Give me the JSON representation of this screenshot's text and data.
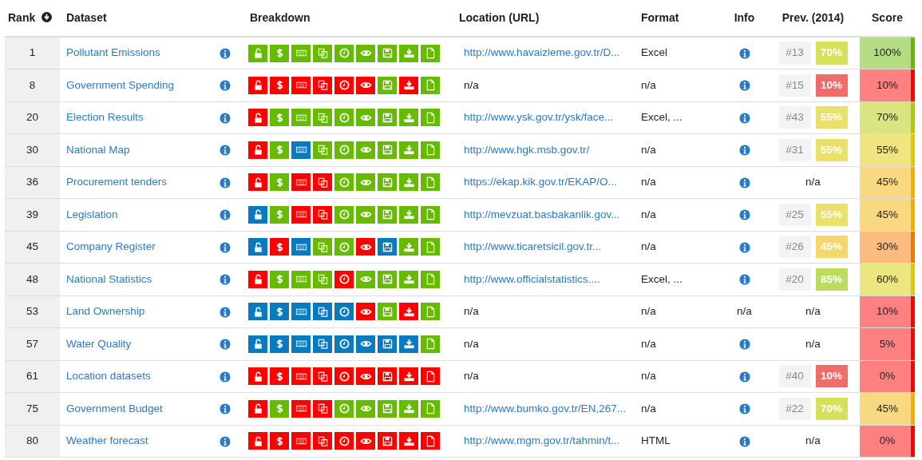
{
  "columns": [
    "Rank",
    "Dataset",
    "Breakdown",
    "Location (URL)",
    "Format",
    "Info",
    "Prev. (2014)",
    "Score"
  ],
  "rows": [
    {
      "rank": "1",
      "dataset": "Pollutant Emissions",
      "breakdown": [
        {
          "color": "#66bb00"
        },
        {
          "color": "#66bb00"
        },
        {
          "color": "#66bb00"
        },
        {
          "color": "#66bb00"
        },
        {
          "color": "#66bb00"
        },
        {
          "color": "#66bb00"
        },
        {
          "color": "#66bb00"
        },
        {
          "color": "#66bb00"
        },
        {
          "color": "#66bb00"
        }
      ],
      "location": {
        "kind": "link",
        "text": "http://www.havaizleme.gov.tr/D..."
      },
      "format": "Excel",
      "info": {
        "kind": "icon"
      },
      "prev": {
        "kind": "badges",
        "rank": "#13",
        "score": "70%",
        "color": "#d5e05b"
      },
      "score": {
        "text": "100%",
        "color": "#66bb00"
      }
    },
    {
      "rank": "8",
      "dataset": "Government Spending",
      "breakdown": [
        {
          "color": "#ff0000"
        },
        {
          "color": "#ff0000"
        },
        {
          "color": "#ff0000"
        },
        {
          "color": "#ff0000"
        },
        {
          "color": "#ff0000"
        },
        {
          "color": "#ff0000"
        },
        {
          "color": "#66bb00"
        },
        {
          "color": "#ff0000"
        },
        {
          "color": "#66bb00"
        }
      ],
      "location": {
        "kind": "text",
        "text": "n/a"
      },
      "format": "n/a",
      "info": {
        "kind": "icon"
      },
      "prev": {
        "kind": "badges",
        "rank": "#15",
        "score": "10%",
        "color": "#f36a6a"
      },
      "score": {
        "text": "10%",
        "color": "#ff0000"
      }
    },
    {
      "rank": "20",
      "dataset": "Election Results",
      "breakdown": [
        {
          "color": "#ff0000"
        },
        {
          "color": "#66bb00"
        },
        {
          "color": "#66bb00"
        },
        {
          "color": "#66bb00"
        },
        {
          "color": "#66bb00"
        },
        {
          "color": "#66bb00"
        },
        {
          "color": "#66bb00"
        },
        {
          "color": "#66bb00"
        },
        {
          "color": "#66bb00"
        }
      ],
      "location": {
        "kind": "link",
        "text": "http://www.ysk.gov.tr/ysk/face..."
      },
      "format": "Excel, ...",
      "info": {
        "kind": "icon"
      },
      "prev": {
        "kind": "badges",
        "rank": "#43",
        "score": "55%",
        "color": "#ebe06a"
      },
      "score": {
        "text": "70%",
        "color": "#b5c800"
      }
    },
    {
      "rank": "30",
      "dataset": "National Map",
      "breakdown": [
        {
          "color": "#ff0000"
        },
        {
          "color": "#66bb00"
        },
        {
          "color": "#0a7abf"
        },
        {
          "color": "#66bb00"
        },
        {
          "color": "#66bb00"
        },
        {
          "color": "#66bb00"
        },
        {
          "color": "#66bb00"
        },
        {
          "color": "#66bb00"
        },
        {
          "color": "#66bb00"
        }
      ],
      "location": {
        "kind": "link",
        "text": "http://www.hgk.msb.gov.tr/"
      },
      "format": "n/a",
      "info": {
        "kind": "icon"
      },
      "prev": {
        "kind": "badges",
        "rank": "#31",
        "score": "55%",
        "color": "#ebe06a"
      },
      "score": {
        "text": "55%",
        "color": "#e0c800"
      }
    },
    {
      "rank": "36",
      "dataset": "Procurement tenders",
      "breakdown": [
        {
          "color": "#ff0000"
        },
        {
          "color": "#66bb00"
        },
        {
          "color": "#ff0000"
        },
        {
          "color": "#ff0000"
        },
        {
          "color": "#66bb00"
        },
        {
          "color": "#66bb00"
        },
        {
          "color": "#66bb00"
        },
        {
          "color": "#66bb00"
        },
        {
          "color": "#66bb00"
        }
      ],
      "location": {
        "kind": "link",
        "text": "https://ekap.kik.gov.tr/EKAP/O..."
      },
      "format": "n/a",
      "info": {
        "kind": "icon"
      },
      "prev": {
        "kind": "text",
        "text": "n/a"
      },
      "score": {
        "text": "45%",
        "color": "#f0b000"
      }
    },
    {
      "rank": "39",
      "dataset": "Legislation",
      "breakdown": [
        {
          "color": "#0a7abf"
        },
        {
          "color": "#66bb00"
        },
        {
          "color": "#ff0000"
        },
        {
          "color": "#ff0000"
        },
        {
          "color": "#66bb00"
        },
        {
          "color": "#66bb00"
        },
        {
          "color": "#66bb00"
        },
        {
          "color": "#66bb00"
        },
        {
          "color": "#66bb00"
        }
      ],
      "location": {
        "kind": "link",
        "text": "http://mevzuat.basbakanlik.gov..."
      },
      "format": "n/a",
      "info": {
        "kind": "icon"
      },
      "prev": {
        "kind": "badges",
        "rank": "#25",
        "score": "55%",
        "color": "#ebe06a"
      },
      "score": {
        "text": "45%",
        "color": "#f0b000"
      }
    },
    {
      "rank": "45",
      "dataset": "Company Register",
      "breakdown": [
        {
          "color": "#0a7abf"
        },
        {
          "color": "#ff0000"
        },
        {
          "color": "#0a7abf"
        },
        {
          "color": "#66bb00"
        },
        {
          "color": "#66bb00"
        },
        {
          "color": "#ff0000"
        },
        {
          "color": "#0a7abf"
        },
        {
          "color": "#66bb00"
        },
        {
          "color": "#66bb00"
        }
      ],
      "location": {
        "kind": "link",
        "text": "http://www.ticaretsicil.gov.tr..."
      },
      "format": "n/a",
      "info": {
        "kind": "icon"
      },
      "prev": {
        "kind": "badges",
        "rank": "#26",
        "score": "45%",
        "color": "#f6d86a"
      },
      "score": {
        "text": "30%",
        "color": "#f77800"
      }
    },
    {
      "rank": "48",
      "dataset": "National Statistics",
      "breakdown": [
        {
          "color": "#ff0000"
        },
        {
          "color": "#66bb00"
        },
        {
          "color": "#66bb00"
        },
        {
          "color": "#66bb00"
        },
        {
          "color": "#ff0000"
        },
        {
          "color": "#66bb00"
        },
        {
          "color": "#66bb00"
        },
        {
          "color": "#66bb00"
        },
        {
          "color": "#66bb00"
        }
      ],
      "location": {
        "kind": "link",
        "text": "http://www.officialstatistics...."
      },
      "format": "Excel, ...",
      "info": {
        "kind": "icon"
      },
      "prev": {
        "kind": "badges",
        "rank": "#20",
        "score": "85%",
        "color": "#bbdc5c"
      },
      "score": {
        "text": "60%",
        "color": "#d6cc00"
      }
    },
    {
      "rank": "53",
      "dataset": "Land Ownership",
      "breakdown": [
        {
          "color": "#0a7abf"
        },
        {
          "color": "#0a7abf"
        },
        {
          "color": "#0a7abf"
        },
        {
          "color": "#0a7abf"
        },
        {
          "color": "#0a7abf"
        },
        {
          "color": "#ff0000"
        },
        {
          "color": "#66bb00"
        },
        {
          "color": "#ff0000"
        },
        {
          "color": "#66bb00"
        }
      ],
      "location": {
        "kind": "text",
        "text": "n/a"
      },
      "format": "n/a",
      "info": {
        "kind": "text",
        "text": "n/a"
      },
      "prev": {
        "kind": "text",
        "text": "n/a"
      },
      "score": {
        "text": "10%",
        "color": "#ff0000"
      }
    },
    {
      "rank": "57",
      "dataset": "Water Quality",
      "breakdown": [
        {
          "color": "#0a7abf"
        },
        {
          "color": "#0a7abf"
        },
        {
          "color": "#0a7abf"
        },
        {
          "color": "#0a7abf"
        },
        {
          "color": "#0a7abf"
        },
        {
          "color": "#0a7abf"
        },
        {
          "color": "#0a7abf"
        },
        {
          "color": "#0a7abf"
        },
        {
          "color": "#66bb00"
        }
      ],
      "location": {
        "kind": "text",
        "text": "n/a"
      },
      "format": "n/a",
      "info": {
        "kind": "icon"
      },
      "prev": {
        "kind": "text",
        "text": "n/a"
      },
      "score": {
        "text": "5%",
        "color": "#ff0000"
      }
    },
    {
      "rank": "61",
      "dataset": "Location datasets",
      "breakdown": [
        {
          "color": "#ff0000"
        },
        {
          "color": "#ff0000"
        },
        {
          "color": "#ff0000"
        },
        {
          "color": "#ff0000"
        },
        {
          "color": "#ff0000"
        },
        {
          "color": "#ff0000"
        },
        {
          "color": "#ff0000"
        },
        {
          "color": "#ff0000"
        },
        {
          "color": "#ff0000"
        }
      ],
      "location": {
        "kind": "text",
        "text": "n/a"
      },
      "format": "n/a",
      "info": {
        "kind": "icon"
      },
      "prev": {
        "kind": "badges",
        "rank": "#40",
        "score": "10%",
        "color": "#f36a6a"
      },
      "score": {
        "text": "0%",
        "color": "#ff0000"
      }
    },
    {
      "rank": "75",
      "dataset": "Government Budget",
      "breakdown": [
        {
          "color": "#ff0000"
        },
        {
          "color": "#66bb00"
        },
        {
          "color": "#ff0000"
        },
        {
          "color": "#ff0000"
        },
        {
          "color": "#66bb00"
        },
        {
          "color": "#66bb00"
        },
        {
          "color": "#66bb00"
        },
        {
          "color": "#66bb00"
        },
        {
          "color": "#66bb00"
        }
      ],
      "location": {
        "kind": "link",
        "text": "http://www.bumko.gov.tr/EN,267..."
      },
      "format": "n/a",
      "info": {
        "kind": "icon"
      },
      "prev": {
        "kind": "badges",
        "rank": "#22",
        "score": "70%",
        "color": "#d5e05b"
      },
      "score": {
        "text": "45%",
        "color": "#f0b000"
      }
    },
    {
      "rank": "80",
      "dataset": "Weather forecast",
      "breakdown": [
        {
          "color": "#ff0000"
        },
        {
          "color": "#ff0000"
        },
        {
          "color": "#ff0000"
        },
        {
          "color": "#ff0000"
        },
        {
          "color": "#ff0000"
        },
        {
          "color": "#ff0000"
        },
        {
          "color": "#ff0000"
        },
        {
          "color": "#ff0000"
        },
        {
          "color": "#ff0000"
        }
      ],
      "location": {
        "kind": "link",
        "text": "http://www.mgm.gov.tr/tahmin/t..."
      },
      "format": "HTML",
      "info": {
        "kind": "icon"
      },
      "prev": {
        "kind": "text",
        "text": "n/a"
      },
      "score": {
        "text": "0%",
        "color": "#ff0000"
      }
    }
  ]
}
